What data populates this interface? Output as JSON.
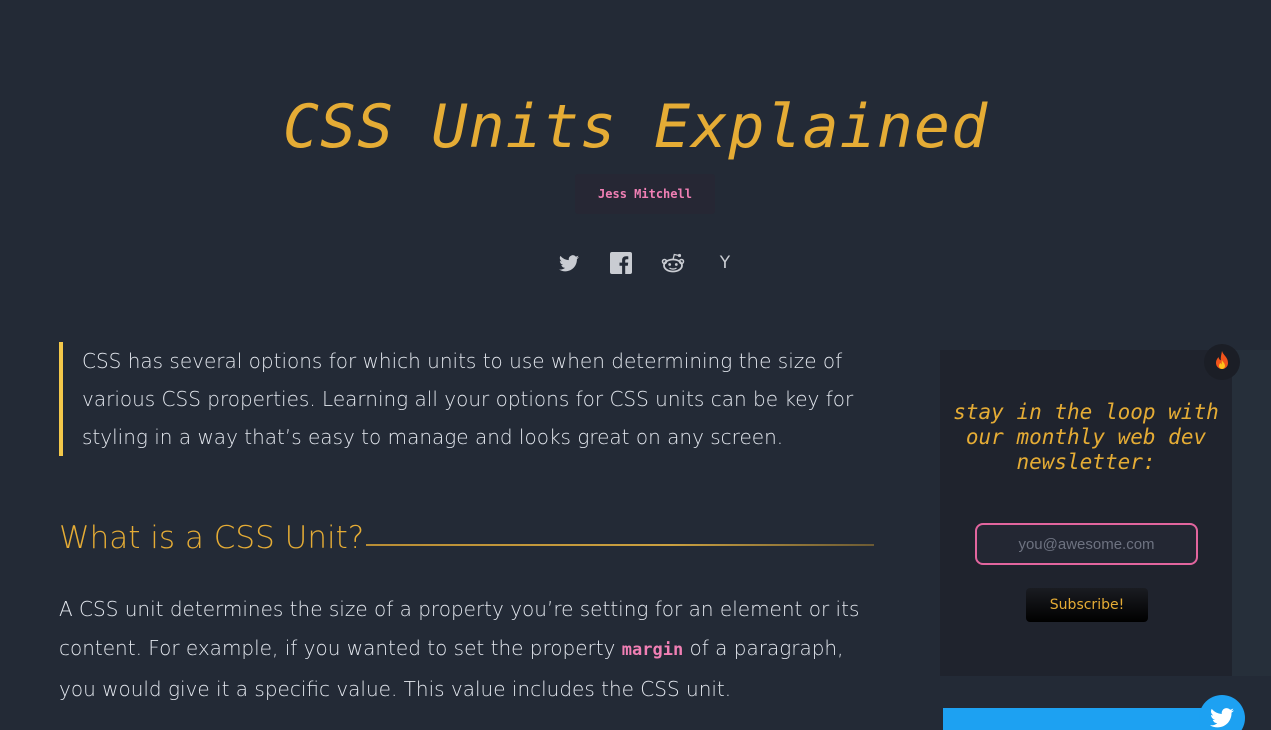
{
  "article": {
    "title": "CSS Units Explained",
    "author": "Jess Mitchell",
    "share": [
      {
        "icon": "twitter-icon"
      },
      {
        "icon": "facebook-icon"
      },
      {
        "icon": "reddit-icon"
      },
      {
        "icon": "hacker-news-icon",
        "glyph": "Y"
      }
    ],
    "intro": "CSS has several options for which units to use when determining the size of various CSS properties. Learning all your options for CSS units can be key for styling in a way that’s easy to manage and looks great on any screen.",
    "section_heading": "What is a CSS Unit?",
    "paragraph_before_code": "A CSS unit determines the size of a property you’re setting for an element or its content. For example, if you wanted to set the property ",
    "paragraph_code": "margin",
    "paragraph_after_code": " of a paragraph, you would give it a specific value. This value includes the CSS unit."
  },
  "newsletter": {
    "heading": "stay in the loop with our monthly web dev newsletter:",
    "email_placeholder": "you@awesome.com",
    "subscribe_label": "Subscribe!"
  },
  "colors": {
    "background": "#232a36",
    "accent": "#e5ac35",
    "code_pink": "#f07fb4",
    "twitter_blue": "#1da1f2"
  }
}
